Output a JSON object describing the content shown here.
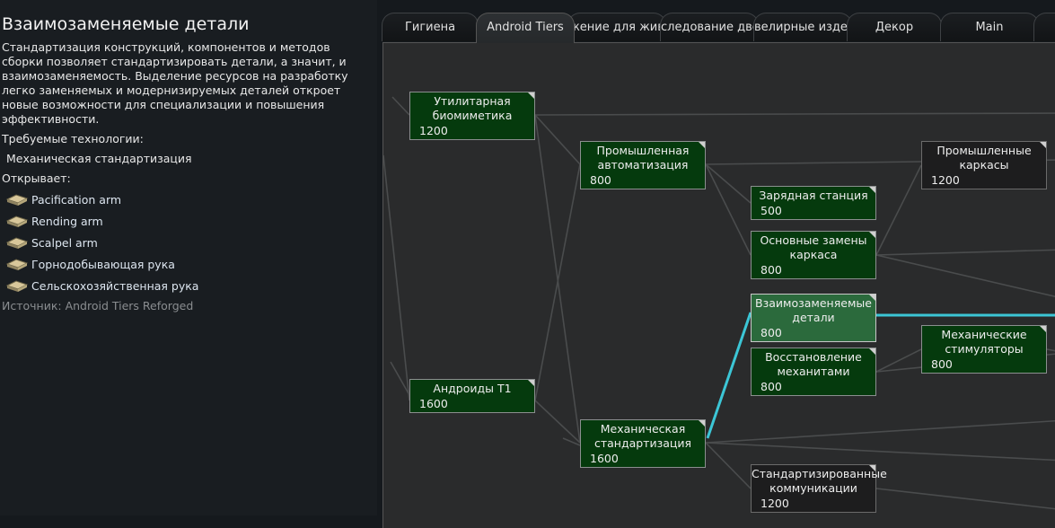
{
  "project": {
    "title": "Взаимозаменяемые детали",
    "description": "Стандартизация конструкций, компонентов и методов сборки позволяет стандартизировать детали, а значит, и взаимозаменяемость. Выделение ресурсов на разработку легко заменяемых и модернизируемых деталей откроет новые возможности для специализации и повышения эффективности.",
    "required_label": "Требуемые технологии:",
    "required": "Механическая стандартизация",
    "unlocks_label": "Открывает:",
    "unlocks": [
      {
        "label": "Pacification arm",
        "icon": "arm-part-icon"
      },
      {
        "label": "Rending arm",
        "icon": "arm-part-icon"
      },
      {
        "label": "Scalpel arm",
        "icon": "arm-part-icon"
      },
      {
        "label": "Горнодобывающая рука",
        "icon": "arm-part-icon"
      },
      {
        "label": "Сельскохозяйственная рука",
        "icon": "arm-part-icon"
      }
    ],
    "source": "Источник:  Android Tiers Reforged"
  },
  "tabs": [
    {
      "label": "Гигиена",
      "active": false
    },
    {
      "label": "Android Tiers",
      "active": true
    },
    {
      "label": "жение для жив",
      "active": false
    },
    {
      "label": "следование две",
      "active": false
    },
    {
      "label": "велирные издел",
      "active": false
    },
    {
      "label": "Декор",
      "active": false
    },
    {
      "label": "Main",
      "active": false
    },
    {
      "label": "",
      "active": false
    }
  ],
  "tree": {
    "nodes": [
      {
        "id": "bio",
        "name": "Утилитарная биомиметика",
        "cost": "1200",
        "state": "done"
      },
      {
        "id": "t1",
        "name": "Андроиды T1",
        "cost": "1600",
        "state": "done"
      },
      {
        "id": "auto",
        "name": "Промышленная автоматизация",
        "cost": "800",
        "state": "done"
      },
      {
        "id": "mstd",
        "name": "Механическая стандартизация",
        "cost": "1600",
        "state": "done"
      },
      {
        "id": "charge",
        "name": "Зарядная станция",
        "cost": "500",
        "state": "done"
      },
      {
        "id": "frame",
        "name": "Основные замены каркаса",
        "cost": "800",
        "state": "done"
      },
      {
        "id": "inter",
        "name": "Взаимозаменяемые детали",
        "cost": "800",
        "state": "selected"
      },
      {
        "id": "mech",
        "name": "Восстановление механитами",
        "cost": "800",
        "state": "done"
      },
      {
        "id": "comms",
        "name": "Стандартизированные коммуникации",
        "cost": "1200",
        "state": "locked"
      },
      {
        "id": "ind",
        "name": "Промышленные каркасы",
        "cost": "1200",
        "state": "locked"
      },
      {
        "id": "stim",
        "name": "Механические стимуляторы",
        "cost": "800",
        "state": "done"
      }
    ]
  },
  "colors": {
    "researched": "#053a0d",
    "selected": "#2b6a3c",
    "locked": "#1d1d1e",
    "highlight_link": "#3cc6d6"
  }
}
